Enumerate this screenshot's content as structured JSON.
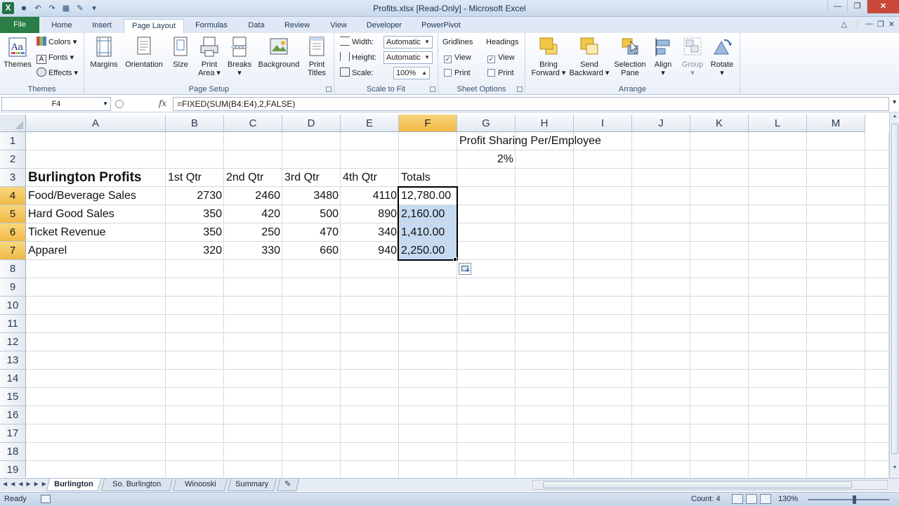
{
  "window": {
    "title": "Profits.xlsx  [Read-Only]  -  Microsoft Excel",
    "app_icon": "X"
  },
  "ribbon_tabs": [
    "File",
    "Home",
    "Insert",
    "Page Layout",
    "Formulas",
    "Data",
    "Review",
    "View",
    "Developer",
    "PowerPivot"
  ],
  "active_tab": "Page Layout",
  "ribbon": {
    "themes": {
      "big_label": "Themes",
      "colors": "Colors",
      "fonts": "Fonts",
      "effects": "Effects",
      "group": "Themes"
    },
    "page_setup": {
      "margins": "Margins",
      "orientation": "Orientation",
      "size": "Size",
      "print_area_1": "Print",
      "print_area_2": "Area",
      "breaks": "Breaks",
      "background": "Background",
      "print_titles_1": "Print",
      "print_titles_2": "Titles",
      "group": "Page Setup"
    },
    "scale_to_fit": {
      "width_label": "Width:",
      "width_value": "Automatic",
      "height_label": "Height:",
      "height_value": "Automatic",
      "scale_label": "Scale:",
      "scale_value": "100%",
      "group": "Scale to Fit"
    },
    "sheet_options": {
      "gridlines": "Gridlines",
      "headings": "Headings",
      "view": "View",
      "print": "Print",
      "group": "Sheet Options"
    },
    "arrange": {
      "bring_forward_1": "Bring",
      "bring_forward_2": "Forward",
      "send_backward_1": "Send",
      "send_backward_2": "Backward",
      "selection_pane_1": "Selection",
      "selection_pane_2": "Pane",
      "align": "Align",
      "group_btn": "Group",
      "rotate": "Rotate",
      "group": "Arrange"
    }
  },
  "formula_bar": {
    "name_box": "F4",
    "fx": "fx",
    "formula": "=FIXED(SUM(B4:E4),2,FALSE)"
  },
  "columns": [
    "A",
    "B",
    "C",
    "D",
    "E",
    "F",
    "G",
    "H",
    "I",
    "J",
    "K",
    "L",
    "M"
  ],
  "rows": [
    "1",
    "2",
    "3",
    "4",
    "5",
    "6",
    "7",
    "8",
    "9",
    "10",
    "11",
    "12",
    "13",
    "14",
    "15",
    "16",
    "17",
    "18",
    "19"
  ],
  "cells": {
    "G1": "Profit Sharing Per/Employee",
    "G2": "2%",
    "A3": "Burlington Profits",
    "B3": "1st Qtr",
    "C3": "2nd Qtr",
    "D3": "3rd Qtr",
    "E3": "4th Qtr",
    "F3": "Totals",
    "A4": "Food/Beverage Sales",
    "B4": "2730",
    "C4": "2460",
    "D4": "3480",
    "E4": "4110",
    "F4": "12,780.00",
    "A5": "Hard Good Sales",
    "B5": "350",
    "C5": "420",
    "D5": "500",
    "E5": "890",
    "F5": "2,160.00",
    "A6": "Ticket Revenue",
    "B6": "350",
    "C6": "250",
    "D6": "470",
    "E6": "340",
    "F6": "1,410.00",
    "A7": "Apparel",
    "B7": "320",
    "C7": "330",
    "D7": "660",
    "E7": "940",
    "F7": "2,250.00"
  },
  "sheets": [
    "Burlington",
    "So. Burlington",
    "Winooski",
    "Summary"
  ],
  "active_sheet": "Burlington",
  "status_bar": {
    "ready": "Ready",
    "count": "Count: 4",
    "zoom": "130%"
  },
  "colors": {
    "selection_fill": "#c5d9f1",
    "header_highlight": "#f1b944",
    "file_tab": "#2a7d44"
  }
}
